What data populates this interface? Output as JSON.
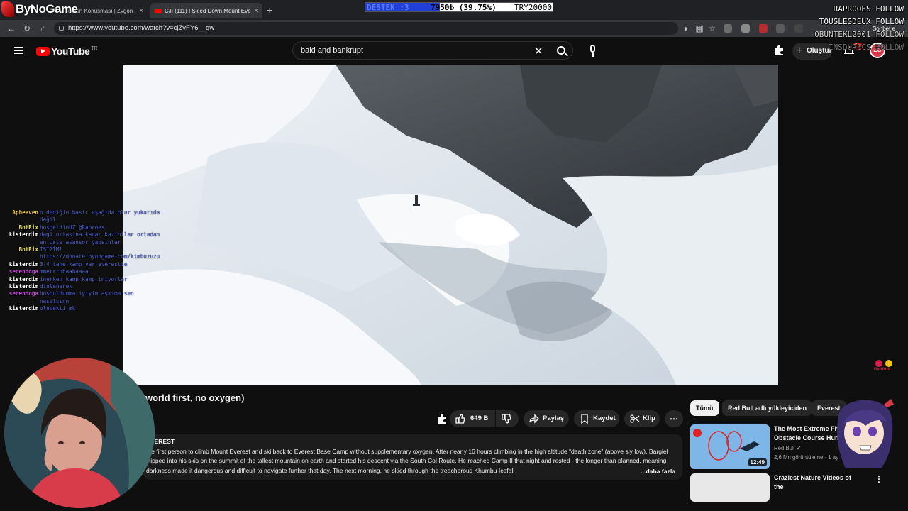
{
  "browser": {
    "tabs": [
      {
        "label": "ktorun Konuşması | Zygon"
      },
      {
        "label": "(111) I Skied Down Mount Eve"
      }
    ],
    "tab_count_prefix": "CJı",
    "url": "https://www.youtube.com/watch?v=cjZvFY6__qw"
  },
  "overlay": {
    "brand": "ByNoGame",
    "donation": {
      "label": "DESTEK :3",
      "amount": "7950₺ (39.75%)",
      "goal": "TRY20000",
      "progress": 0.3975
    },
    "follows": [
      "RAPROOES FOLLOW",
      "TOUSLESDEUX FOLLOW",
      "OBUNTEKL2001 FOLLOW",
      "INSDURECS FOLLOW"
    ],
    "sohbet": "Sohbet e",
    "chat": [
      {
        "user": "Apheaven",
        "color": "#e8c64a",
        "text": "o dediğin basic aşağıda olur yukarıda değil"
      },
      {
        "user": "BotRix",
        "color": "#e8e04a",
        "text": "hoşgeldinUZ @Raproes"
      },
      {
        "user": "kisterdim",
        "color": "#ffffff",
        "text": "dagi ortasina kadar kazinilar ortadan en uste asansor yapsinlar"
      },
      {
        "user": "BotRix",
        "color": "#e8e04a",
        "text": "İSİZİM! https://donate.bynogame.com/kimbuzuzu"
      },
      {
        "user": "kisterdim",
        "color": "#ffffff",
        "text": "3-4 tane kamp var everestte"
      },
      {
        "user": "senendoga",
        "color": "#c34ad6",
        "text": "mmerrrhhaabaaaa"
      },
      {
        "user": "kisterdim",
        "color": "#ffffff",
        "text": "inerken kamp kamp iniyorlar"
      },
      {
        "user": "kisterdim",
        "color": "#ffffff",
        "text": "dinlenerek"
      },
      {
        "user": "senendoga",
        "color": "#c34ad6",
        "text": "hoşbuldumma iyiyim aşkıma sen nasılsınn"
      },
      {
        "user": "kisterdim",
        "color": "#ffffff",
        "text": "olecekti mk"
      }
    ]
  },
  "youtube": {
    "logo_text": "YouTube",
    "country": "TR",
    "search_query": "bald and bankrupt",
    "create_label": "Oluştur",
    "notifications": "9+",
    "avatar_text": "ZG",
    "video_title": "world first, no oxygen)",
    "actions": {
      "likes": "649 B",
      "share": "Paylaş",
      "save": "Kaydet",
      "clip": "Klip"
    },
    "description": {
      "label": "EVEREST",
      "text": "the first person to climb Mount Everest and ski back to Everest Base Camp without supplementary oxygen. After nearly 16 hours climbing in the high altitude “death zone” (above sly low), Bargiel clipped into his skis on the summit of the tallest mountain on earth and started his descent via the South Col Route. He reached Camp II that night and rested - the longer than planned, meaning darkness made it dangerous and difficult to navigate further that day. The next morning, he skied through the treacherous Khumbu Icefall",
      "more": "...daha fazla"
    },
    "chips": [
      "Tümü",
      "Red Bull adlı yükleyiciden",
      "Everest"
    ],
    "recommendations": [
      {
        "title": "The Most Extreme Flying Obstacle Course Huma",
        "channel": "Red Bull",
        "meta": "2,6 Mn görüntüleme · 1 ay",
        "duration": "12:49"
      },
      {
        "title": "Craziest Nature Videos of the",
        "channel": "",
        "meta": "",
        "duration": ""
      }
    ]
  },
  "colors": {
    "accent": "#ff0000",
    "bg": "#0f0f0f",
    "chat_text": "#4e5fd6"
  }
}
